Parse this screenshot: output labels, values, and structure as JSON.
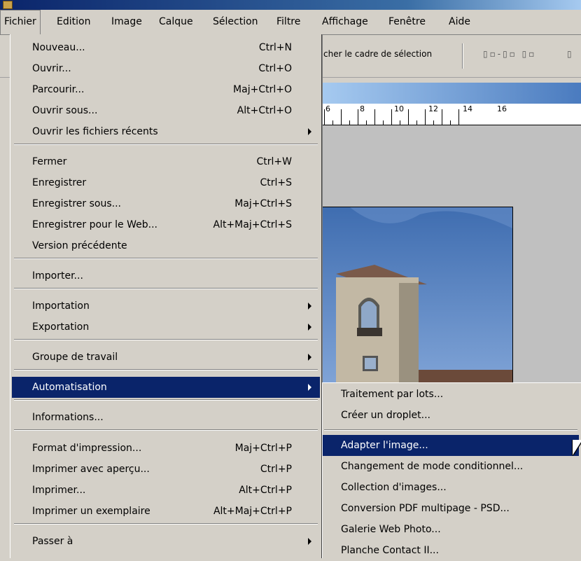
{
  "menubar": {
    "items": [
      "Fichier",
      "Edition",
      "Image",
      "Calque",
      "Sélection",
      "Filtre",
      "Affichage",
      "Fenêtre",
      "Aide"
    ]
  },
  "optionsbar": {
    "hide_selection_text": "cher le cadre de sélection",
    "align_icons": "▯▫-▯▫ ▯▫",
    "align_icons_more": "▯"
  },
  "ruler": {
    "labels": [
      "6",
      "8",
      "10",
      "12",
      "14",
      "16"
    ]
  },
  "fichier_menu": {
    "items": [
      {
        "label": "Nouveau...",
        "shortcut": "Ctrl+N"
      },
      {
        "label": "Ouvrir...",
        "shortcut": "Ctrl+O"
      },
      {
        "label": "Parcourir...",
        "shortcut": "Maj+Ctrl+O"
      },
      {
        "label": "Ouvrir sous...",
        "shortcut": "Alt+Ctrl+O"
      },
      {
        "label": "Ouvrir les fichiers récents",
        "shortcut": ""
      },
      {
        "label": "Fermer",
        "shortcut": "Ctrl+W"
      },
      {
        "label": "Enregistrer",
        "shortcut": "Ctrl+S"
      },
      {
        "label": "Enregistrer sous...",
        "shortcut": "Maj+Ctrl+S"
      },
      {
        "label": "Enregistrer pour le Web...",
        "shortcut": "Alt+Maj+Ctrl+S"
      },
      {
        "label": "Version précédente",
        "shortcut": ""
      },
      {
        "label": "Importer...",
        "shortcut": ""
      },
      {
        "label": "Importation",
        "shortcut": ""
      },
      {
        "label": "Exportation",
        "shortcut": ""
      },
      {
        "label": "Groupe de travail",
        "shortcut": ""
      },
      {
        "label": "Automatisation",
        "shortcut": ""
      },
      {
        "label": "Informations...",
        "shortcut": ""
      },
      {
        "label": "Format d'impression...",
        "shortcut": "Maj+Ctrl+P"
      },
      {
        "label": "Imprimer avec aperçu...",
        "shortcut": "Ctrl+P"
      },
      {
        "label": "Imprimer...",
        "shortcut": "Alt+Ctrl+P"
      },
      {
        "label": "Imprimer un exemplaire",
        "shortcut": "Alt+Maj+Ctrl+P"
      },
      {
        "label": "Passer à",
        "shortcut": ""
      }
    ]
  },
  "automatisation_submenu": {
    "items": [
      "Traitement par lots...",
      "Créer un droplet...",
      "Adapter l'image...",
      "Changement de mode conditionnel...",
      "Collection d'images...",
      "Conversion PDF multipage - PSD...",
      "Galerie Web Photo...",
      "Planche Contact II..."
    ]
  },
  "colors": {
    "selection": "#0a246a",
    "menu_bg": "#d4d0c8"
  },
  "icons": {
    "submenu_arrow": "triangle-right-icon",
    "cursor": "arrow-cursor-icon"
  }
}
